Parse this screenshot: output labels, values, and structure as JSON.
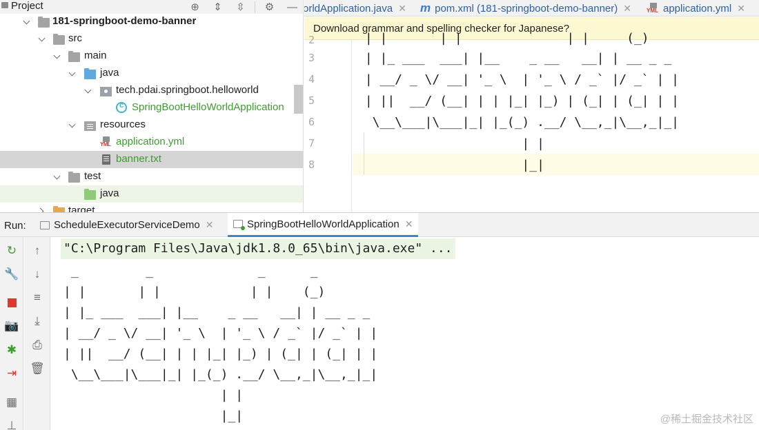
{
  "project_panel": {
    "title": "Project",
    "header_icons": [
      "target-icon",
      "expand-all-icon",
      "collapse-all-icon",
      "gear-icon",
      "minimize-icon"
    ],
    "tree": [
      {
        "label": "181-springboot-demo-banner",
        "icon": "module-folder-icon",
        "expanded": true,
        "bold": true
      },
      {
        "label": "src",
        "icon": "folder-icon",
        "expanded": true
      },
      {
        "label": "main",
        "icon": "folder-icon",
        "expanded": true
      },
      {
        "label": "java",
        "icon": "source-folder-icon",
        "expanded": true
      },
      {
        "label": "tech.pdai.springboot.helloworld",
        "icon": "package-icon",
        "expanded": true
      },
      {
        "label": "SpringBootHelloWorldApplication",
        "icon": "class-icon"
      },
      {
        "label": "resources",
        "icon": "resources-folder-icon",
        "expanded": true
      },
      {
        "label": "application.yml",
        "icon": "yml-file-icon"
      },
      {
        "label": "banner.txt",
        "icon": "text-file-icon",
        "selected": true
      },
      {
        "label": "test",
        "icon": "folder-icon",
        "expanded": true
      },
      {
        "label": "java",
        "icon": "test-folder-icon"
      },
      {
        "label": "target",
        "icon": "excluded-folder-icon",
        "expanded": false
      }
    ]
  },
  "editor": {
    "tabs": [
      {
        "label": "orldApplication.java",
        "icon": "class-icon"
      },
      {
        "label": "pom.xml (181-springboot-demo-banner)",
        "icon": "maven-icon"
      },
      {
        "label": "application.yml",
        "icon": "yml-file-icon"
      }
    ],
    "notification": "Download grammar and spelling checker for Japanese?",
    "line_numbers": [
      "2",
      "3",
      "4",
      "5",
      "6",
      "7",
      "8"
    ],
    "code_lines": [
      " | |       | |              | |     (_)",
      " | |_ ___  ___| |__    _ __   __| | __ _ _",
      " | __/ _ \\/ __| '_ \\  | '_ \\ / _` |/ _` | |",
      " | ||  __/ (__| | | |_| |_) | (_| | (_| | |",
      "  \\__\\___|\\___|_| |_(_) .__/ \\__,_|\\__,_|_|",
      "                      | |",
      "                      |_|"
    ]
  },
  "run_panel": {
    "label": "Run:",
    "tabs": [
      {
        "label": "ScheduleExecutorServiceDemo",
        "active": false
      },
      {
        "label": "SpringBootHelloWorldApplication",
        "active": true
      }
    ],
    "toolbar_1": [
      "rerun-icon",
      "wrench-icon",
      "stop-icon",
      "camera-icon",
      "debug-bug-icon",
      "login-icon",
      "layout-icon",
      "pin-icon"
    ],
    "toolbar_2": [
      "arrow-up-icon",
      "arrow-down-icon",
      "soft-wrap-icon",
      "scroll-to-end-icon",
      "print-icon",
      "trash-icon"
    ],
    "command": "\"C:\\Program Files\\Java\\jdk1.8.0_65\\bin\\java.exe\" ...",
    "console_lines": [
      " _         _              _      _",
      "| |       | |            | |    (_)",
      "| |_ ___  ___| |__    _ __   __| | __ _ _",
      "| __/ _ \\/ __| '_ \\  | '_ \\ / _` |/ _` | |",
      "| ||  __/ (__| | | |_| |_) | (_| | (_| | |",
      " \\__\\___|\\___|_| |_(_) .__/ \\__,_|\\__,_|_|",
      "                     | |",
      "                     |_|"
    ]
  },
  "watermark": "@稀土掘金技术社区",
  "colors": {
    "accent": "#4083c9",
    "selection": "#d5d5d5",
    "notification_bg": "#fbf8d2",
    "green_text": "#3d9d2f"
  }
}
